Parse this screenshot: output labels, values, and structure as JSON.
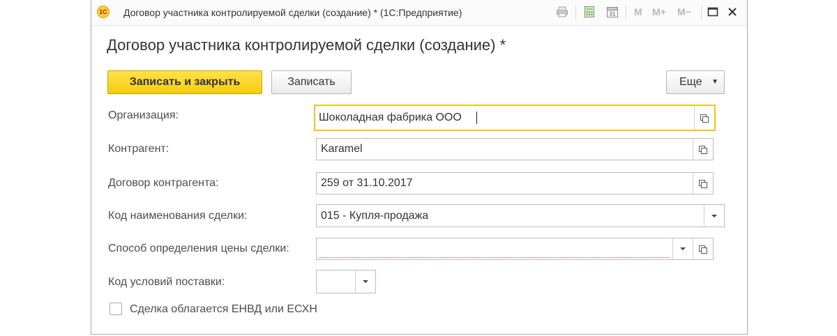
{
  "window": {
    "title": "Договор участника контролируемой сделки (создание) * (1С:Предприятие)",
    "logo_text": "1С",
    "toolbar_icons": [
      "print-icon",
      "calculator-icon",
      "calendar-icon"
    ],
    "calendar_day": "31",
    "memory_buttons": [
      "M",
      "M+",
      "M−"
    ],
    "controls": [
      "maximize-icon",
      "close-icon"
    ]
  },
  "form": {
    "heading": "Договор участника контролируемой сделки (создание) *",
    "buttons": {
      "save_close": "Записать и закрыть",
      "save": "Записать",
      "more": "Еще"
    },
    "fields": [
      {
        "label": "Организация:",
        "value": "Шоколадная фабрика ООО"
      },
      {
        "label": "Контрагент:",
        "value": "Karamel"
      },
      {
        "label": "Договор контрагента:",
        "value": "259 от 31.10.2017"
      },
      {
        "label": "Код наименования сделки:",
        "value": "015 - Купля-продажа"
      },
      {
        "label": "Способ определения цены сделки:",
        "value": ""
      },
      {
        "label": "Код условий поставки:",
        "value": ""
      }
    ],
    "checkbox": {
      "label": "Сделка облагается ЕНВД или ЕСХН",
      "checked": false
    }
  },
  "colors": {
    "accent": "#f5cc0e",
    "focus_border": "#f2c417",
    "invalid": "#d23c3c"
  }
}
